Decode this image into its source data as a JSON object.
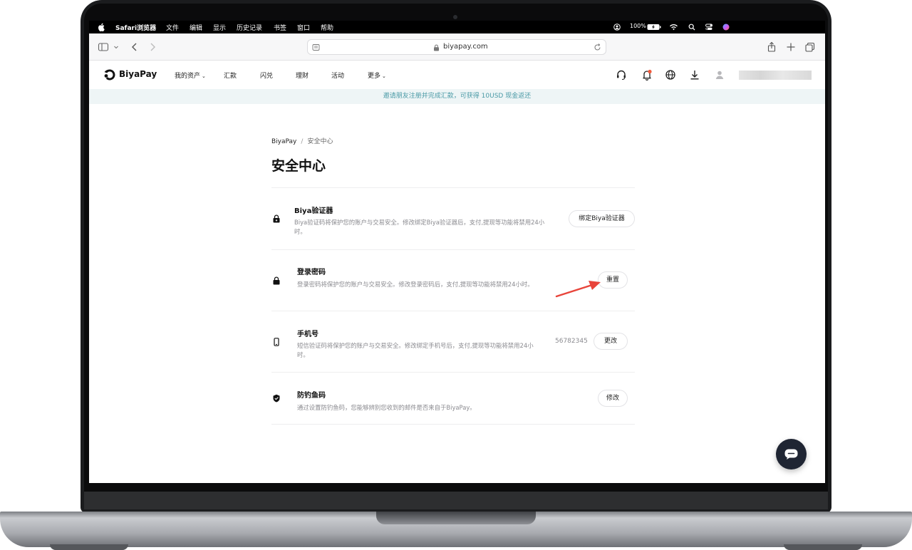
{
  "menubar": {
    "app_name": "Safari浏览器",
    "items": [
      "文件",
      "编辑",
      "显示",
      "历史记录",
      "书签",
      "窗口",
      "帮助"
    ],
    "battery": "100%"
  },
  "browser": {
    "url": "biyapay.com"
  },
  "site": {
    "brand": "BiyaPay",
    "nav": [
      "我的资产",
      "汇款",
      "闪兑",
      "理财",
      "活动",
      "更多"
    ],
    "promo": "邀请朋友注册并完成汇款，可获得 10USD 现金返还"
  },
  "breadcrumb": {
    "root": "BiyaPay",
    "separator": "/",
    "current": "安全中心"
  },
  "page_title": "安全中心",
  "security_items": [
    {
      "icon": "authenticator-lock-icon",
      "title": "Biya验证器",
      "description": "Biya验证码将保护您的账户与交易安全。修改绑定Biya验证器后，支付,提现等功能将禁用24小时。",
      "value": "",
      "button": "绑定Biya验证器"
    },
    {
      "icon": "padlock-icon",
      "title": "登录密码",
      "description": "登录密码将保护您的账户与交易安全。修改登录密码后，支付,提现等功能将禁用24小时。",
      "value": "",
      "button": "重置"
    },
    {
      "icon": "phone-icon",
      "title": "手机号",
      "description": "短信验证码将保护您的账户与交易安全。修改绑定手机号后，支付,提现等功能将禁用24小时。",
      "value": "56782345",
      "button": "更改"
    },
    {
      "icon": "shield-check-icon",
      "title": "防钓鱼码",
      "description": "通过设置防钓鱼码，您能够辨别您收到的邮件是否来自于BiyaPay。",
      "value": "",
      "button": "修改"
    }
  ],
  "colors": {
    "accent_teal": "#4a9aa6",
    "promo_bg": "#eef5f6",
    "arrow_red": "#e8443a",
    "fab_dark": "#1f2533",
    "notification_dot": "#f05a3c"
  }
}
